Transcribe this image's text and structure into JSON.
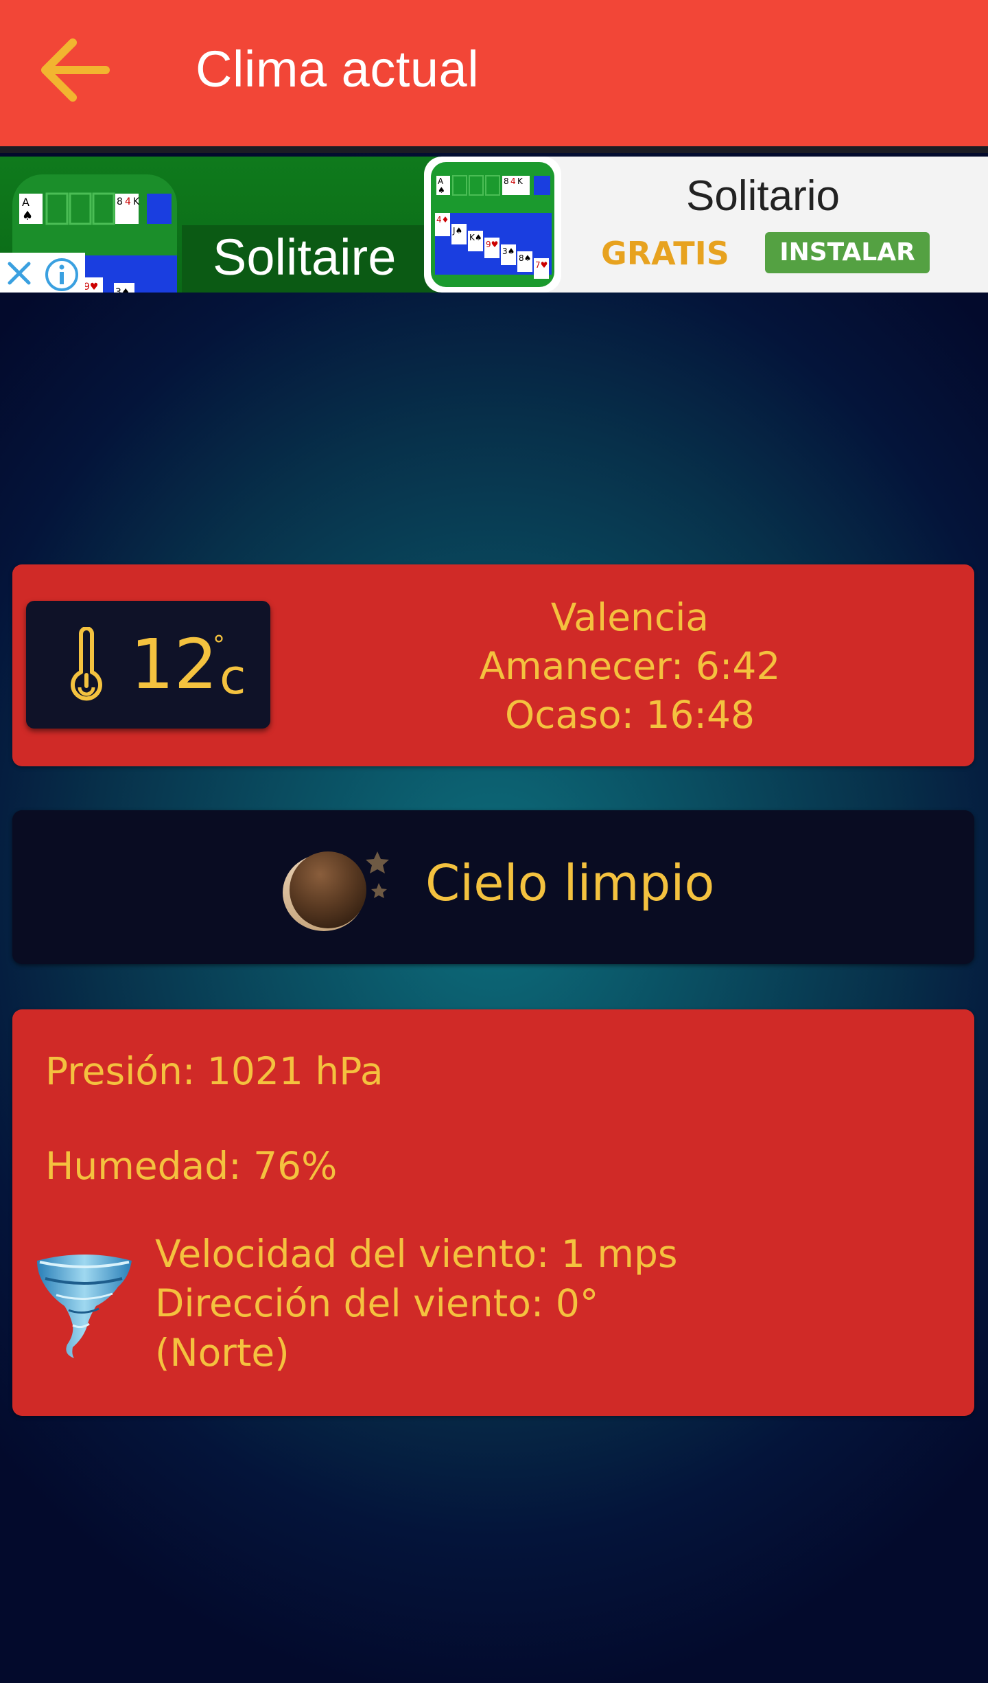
{
  "appbar": {
    "title": "Clima actual",
    "back_icon": "arrow-left-icon",
    "background": "#f24637"
  },
  "ad": {
    "left_banner_text": "Solitaire",
    "app_name": "Solitario",
    "price_label": "GRATIS",
    "install_label": "INSTALAR",
    "close_icon": "close-icon",
    "info_icon": "info-icon"
  },
  "current": {
    "temperature": "12",
    "temperature_degree": "°",
    "temperature_unit": "c",
    "city": "Valencia",
    "sunrise": "Amanecer: 6:42",
    "sunset": "Ocaso: 16:48",
    "condition": "Cielo limpio",
    "condition_icon": "moon-stars-icon"
  },
  "details": {
    "pressure": "Presión: 1021 hPa",
    "humidity": "Humedad: 76%",
    "wind_speed": "Velocidad del viento: 1 mps",
    "wind_direction": "Dirección del viento: 0°",
    "wind_direction_name": "(Norte)",
    "wind_icon": "tornado-icon"
  },
  "colors": {
    "accent_text": "#f4c23f",
    "card_red": "#d02a27",
    "card_dark": "#090c22",
    "install_button": "#54a142"
  }
}
